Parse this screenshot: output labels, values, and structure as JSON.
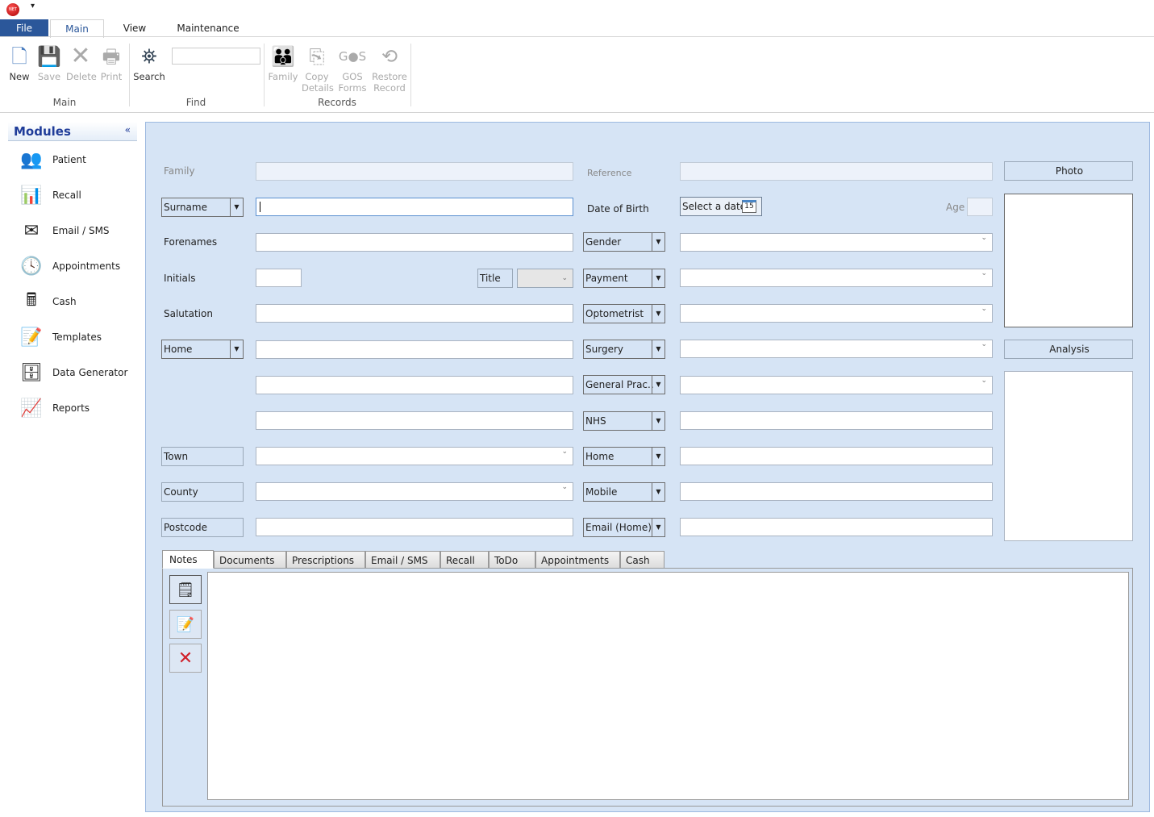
{
  "app": {
    "logo_text": "NET"
  },
  "ribbon": {
    "tabs": [
      {
        "label": "File"
      },
      {
        "label": "Main"
      },
      {
        "label": "View"
      },
      {
        "label": "Maintenance"
      }
    ],
    "groups": {
      "main": "Main",
      "find": "Find",
      "records": "Records"
    },
    "buttons": {
      "new": "New",
      "save": "Save",
      "delete": "Delete",
      "print": "Print",
      "search": "Search",
      "family": "Family",
      "copy1": "Copy",
      "copy2": "Details",
      "gos1": "GOS",
      "gos2": "Forms",
      "restore1": "Restore",
      "restore2": "Record",
      "gos_icon_text": "G●S"
    },
    "find_value": ""
  },
  "modules": {
    "title": "Modules",
    "collapse": "«",
    "items": [
      {
        "label": "Patient"
      },
      {
        "label": "Recall"
      },
      {
        "label": "Email / SMS"
      },
      {
        "label": "Appointments"
      },
      {
        "label": "Cash"
      },
      {
        "label": "Templates"
      },
      {
        "label": "Data Generator"
      },
      {
        "label": "Reports"
      }
    ]
  },
  "form": {
    "family": "Family",
    "reference": "Reference",
    "surname": "Surname",
    "dob": "Date of Birth",
    "date_placeholder": "Select a date",
    "calendar_day": "15",
    "age": "Age",
    "forenames": "Forenames",
    "initials": "Initials",
    "title": "Title",
    "salutation": "Salutation",
    "address_type": "Home",
    "town": "Town",
    "county": "County",
    "postcode": "Postcode",
    "combos": [
      "Gender",
      "Payment",
      "Optometrist",
      "Surgery",
      "General Prac..",
      "NHS",
      "Home",
      "Mobile",
      "Email (Home)"
    ],
    "photo": "Photo",
    "analysis": "Analysis"
  },
  "bottom_tabs": [
    {
      "label": "Notes"
    },
    {
      "label": "Documents"
    },
    {
      "label": "Prescriptions"
    },
    {
      "label": "Email / SMS"
    },
    {
      "label": "Recall"
    },
    {
      "label": "ToDo"
    },
    {
      "label": "Appointments"
    },
    {
      "label": "Cash"
    }
  ],
  "colors": {
    "file_tab": "#2b579a",
    "form_bg": "#d6e4f5",
    "modules_title": "#1f3c99"
  }
}
